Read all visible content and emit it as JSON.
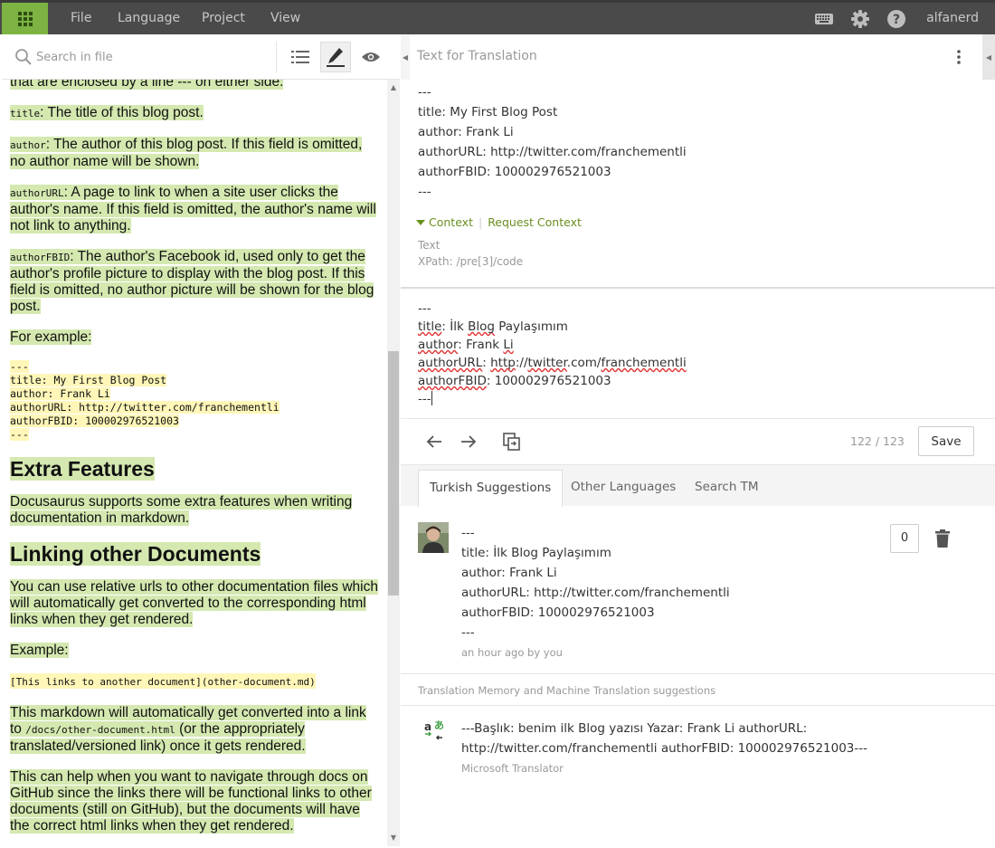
{
  "topbar": {
    "menu": [
      "File",
      "Language",
      "Project",
      "View"
    ],
    "username": "alfanerd"
  },
  "left": {
    "search_placeholder": "Search in file",
    "doc": {
      "p0": "that are enclosed by a line --- on either side:",
      "p1_code": "title",
      "p1_text": ": The title of this blog post.",
      "p2_code": "author",
      "p2_text": ": The author of this blog post. If this field is omitted, no author name will be shown.",
      "p3_code": "authorURL",
      "p3_text": ": A page to link to when a site user clicks the author's name. If this field is omitted, the author's name will not link to anything.",
      "p4_code": "authorFBID",
      "p4_text": ": The author's Facebook id, used only to get the author's profile picture to display with the blog post. If this field is omitted, no author picture will be shown for the blog post.",
      "p5": "For example:",
      "code_block": [
        "---",
        "title: My First Blog Post",
        "author: Frank Li",
        "authorURL: http://twitter.com/franchementli",
        "authorFBID: 100002976521003",
        "---"
      ],
      "h_extra": "Extra Features",
      "p6": "Docusaurus supports some extra features when writing documentation in markdown.",
      "h_linking": "Linking other Documents",
      "p7": "You can use relative urls to other documentation files which will automatically get converted to the corresponding html links when they get rendered.",
      "p8": "Example:",
      "p9_code": "[This links to another document](other-document.md)",
      "p10_a": "This markdown will automatically get converted into a link to ",
      "p10_code": "/docs/other-document.html",
      "p10_b": " (or the appropriately translated/versioned link) once it gets rendered.",
      "p11": "This can help when you want to navigate through docs on GitHub since the links there will be functional links to other documents (still on GitHub), but the documents will have the correct html links when they get rendered."
    }
  },
  "right": {
    "source_header": "Text for Translation",
    "source_lines": [
      "---",
      "title: My First Blog Post",
      "author: Frank Li",
      "authorURL: http://twitter.com/franchementli",
      "authorFBID: 100002976521003",
      "---"
    ],
    "context_label": "Context",
    "request_context": "Request Context",
    "context_type": "Text",
    "context_xpath": "XPath: /pre[3]/code",
    "translation": {
      "l0": "---",
      "l1_key": "title",
      "l1_rest_a": ": İlk ",
      "l1_blog": "Blog",
      "l1_rest_b": " Paylaşımım",
      "l2_key": "author",
      "l2_rest_a": ": Frank ",
      "l2_li": "Li",
      "l3_key": "authorURL",
      "l3_rest_a": ": ",
      "l3_http": "http",
      "l3_rest_b": "://",
      "l3_twitter": "twitter",
      "l3_rest_c": ".com/",
      "l3_fr": "franchementli",
      "l4_key": "authorFBID",
      "l4_rest": ": 100002976521003",
      "l5": "---"
    },
    "counter": "122 / 123",
    "save_label": "Save",
    "tabs": [
      "Turkish Suggestions",
      "Other Languages",
      "Search TM"
    ],
    "suggestion_lines": [
      "---",
      "title: İlk Blog Paylaşımım",
      "author: Frank Li",
      "authorURL: http://twitter.com/franchementli",
      "authorFBID: 100002976521003",
      "---"
    ],
    "suggestion_meta": "an hour ago by you",
    "vote_count": "0",
    "tm_header": "Translation Memory and Machine Translation suggestions",
    "mt_text": "---Başlık: benim ilk Blog yazısı Yazar: Frank Li authorURL: http://twitter.com/franchementli authorFBID: 100002976521003---",
    "mt_provider": "Microsoft Translator"
  },
  "colors": {
    "accent_green": "#7cb342",
    "topbar_bg": "#4a4a4a",
    "highlight": "#d4e8b0",
    "code_highlight": "#fff6b8",
    "link_green": "#6a8f1f"
  }
}
